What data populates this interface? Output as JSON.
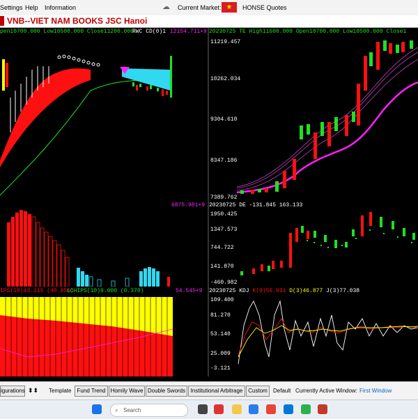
{
  "menubar": {
    "settings": "Settings",
    "help": "Help",
    "information": "Information",
    "current_market": "Current Market:",
    "market_flag": "★",
    "quotes": "HONSE Quotes"
  },
  "title": "VNB--VIET NAM BOOKS JSC  Hanoi",
  "panels": {
    "price_left": {
      "header": "pen10700.000 Low10500.000 Close11200.000",
      "indicator": "RWC CD(0)1",
      "value": "12154.711+9"
    },
    "price_right": {
      "header": "20230725 TE High11600.000 Open10700.000 Low10500.000 Close1",
      "y_ticks": [
        "11219.457",
        "10262.034",
        "9304.610",
        "8347.186",
        "7389.762"
      ]
    },
    "de_left": {
      "value": "6875.981+9"
    },
    "de_right": {
      "header": "20230725 DE -131.845 163.133",
      "y_ticks": [
        "1950.425",
        "1347.573",
        "744.722",
        "141.870",
        "-460.982"
      ]
    },
    "kdj_left": {
      "header_red": "IPS(10)43.115 (40.956)",
      "header_green": "LCHIPS(10)0.000 (0.370)",
      "value": "54.545+9"
    },
    "kdj_right": {
      "header_white": "20230725 KDJ",
      "header_k": "K(9)56.931",
      "header_d": "D(3)46.877",
      "header_j": "J(3)77.038",
      "y_ticks": [
        "109.400",
        "81.270",
        "53.140",
        "25.009",
        "-3.121"
      ]
    }
  },
  "bottombar": {
    "config": "igurations",
    "arrows": "⬍⬍",
    "template": "Template",
    "fund_trend": "Fund Trend",
    "homily_wave": "Homily Wave",
    "double_swords": "Double Swords",
    "institutional_arbitrage": "Institutional Arbitrage",
    "custom": "Custom",
    "default": "Default",
    "active_window_label": "Currently Active Window:",
    "active_window": "First Window"
  },
  "taskbar": {
    "search_placeholder": "Search"
  },
  "colors": {
    "up": "#20e020",
    "down": "#ff1010",
    "yellow": "#ffff00",
    "magenta": "#ff20ff",
    "cyan": "#30d8f0",
    "title_red": "#c00000",
    "link_blue": "#0066cc"
  }
}
